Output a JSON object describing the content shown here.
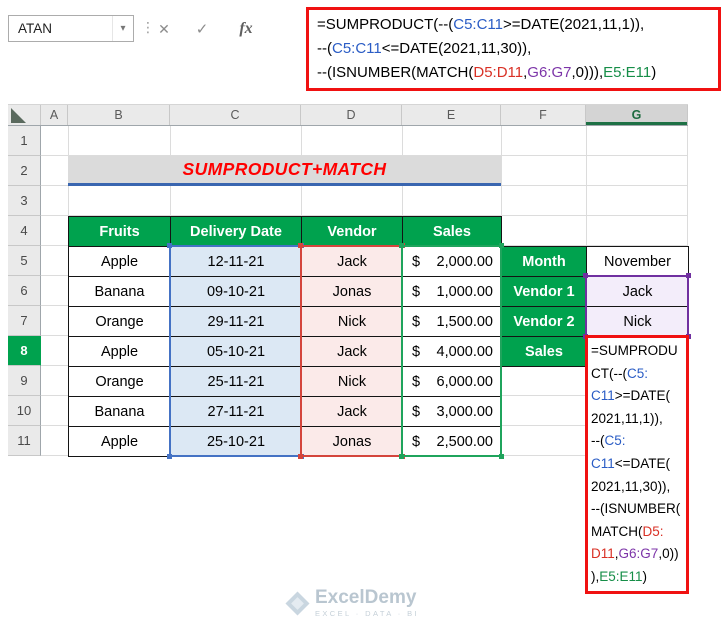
{
  "colors": {
    "header_green": "#00A24E",
    "selection_red": "#F01111",
    "title_text": "#FF0000",
    "title_bg": "#DBDBDB",
    "title_rule": "#3A66B0",
    "range_borders": {
      "c_column": "#4472C4",
      "d_column": "#D4453C",
      "e_column": "#1FA45C",
      "g_rows": "#7030A0"
    },
    "cell_fills": {
      "dates": "#DCE8F4",
      "vendors": "#FBEAE9",
      "lookup_vendors": "#F3EDFA"
    },
    "formula": {
      "plain": "#000000",
      "blue": "#2A5CC5",
      "red": "#D93025",
      "purple": "#7C34A8",
      "green": "#168E48"
    },
    "watermark_text": "#B9C6D0"
  },
  "name_box": {
    "value": "ATAN"
  },
  "toolbar": {
    "dropdown": "▾",
    "grip": "⋮",
    "cancel": "✕",
    "enter": "✓",
    "fx": "fx"
  },
  "formula_bar": {
    "lines": [
      [
        {
          "t": "=SUMPRODUCT(--("
        },
        {
          "t": "C5:C11",
          "c": "blue"
        },
        {
          "t": ">=DATE(2021,11,1)),"
        }
      ],
      [
        {
          "t": "--("
        },
        {
          "t": "C5:C11",
          "c": "blue"
        },
        {
          "t": "<=DATE(2021,11,30)),"
        }
      ],
      [
        {
          "t": "--(ISNUMBER(MATCH("
        },
        {
          "t": "D5:D11",
          "c": "red"
        },
        {
          "t": ","
        },
        {
          "t": "G6:G7",
          "c": "purple"
        },
        {
          "t": ",0))),"
        },
        {
          "t": "E5:E11",
          "c": "green"
        },
        {
          "t": ")"
        }
      ]
    ]
  },
  "sheet": {
    "columns": [
      "A",
      "B",
      "C",
      "D",
      "E",
      "F",
      "G"
    ],
    "rows": [
      "1",
      "2",
      "3",
      "4",
      "5",
      "6",
      "7",
      "8",
      "9",
      "10",
      "11"
    ],
    "active_cell": "G8"
  },
  "title": {
    "text": "SUMPRODUCT+MATCH"
  },
  "main_table": {
    "headers": [
      "Fruits",
      "Delivery Date",
      "Vendor",
      "Sales"
    ],
    "rows": [
      {
        "fruit": "Apple",
        "date": "12-11-21",
        "vendor": "Jack",
        "currency": "$",
        "sales": "2,000.00"
      },
      {
        "fruit": "Banana",
        "date": "09-10-21",
        "vendor": "Jonas",
        "currency": "$",
        "sales": "1,000.00"
      },
      {
        "fruit": "Orange",
        "date": "29-11-21",
        "vendor": "Nick",
        "currency": "$",
        "sales": "1,500.00"
      },
      {
        "fruit": "Apple",
        "date": "05-10-21",
        "vendor": "Jack",
        "currency": "$",
        "sales": "4,000.00"
      },
      {
        "fruit": "Orange",
        "date": "25-11-21",
        "vendor": "Nick",
        "currency": "$",
        "sales": "6,000.00"
      },
      {
        "fruit": "Banana",
        "date": "27-11-21",
        "vendor": "Jack",
        "currency": "$",
        "sales": "3,000.00"
      },
      {
        "fruit": "Apple",
        "date": "25-10-21",
        "vendor": "Jonas",
        "currency": "$",
        "sales": "2,500.00"
      }
    ]
  },
  "lookup_table": {
    "rows": [
      {
        "label": "Month",
        "value": "November"
      },
      {
        "label": "Vendor 1",
        "value": "Jack"
      },
      {
        "label": "Vendor 2",
        "value": "Nick"
      },
      {
        "label": "Sales",
        "value": ""
      }
    ]
  },
  "cell_formula": {
    "lines": [
      [
        {
          "t": "=SUMPRODU"
        }
      ],
      [
        {
          "t": "CT(--("
        },
        {
          "t": "C5:",
          "c": "blue"
        }
      ],
      [
        {
          "t": "C11",
          "c": "blue"
        },
        {
          "t": ">=DATE("
        }
      ],
      [
        {
          "t": "2021,11,1)),"
        }
      ],
      [
        {
          "t": "--("
        },
        {
          "t": "C5:",
          "c": "blue"
        }
      ],
      [
        {
          "t": "C11",
          "c": "blue"
        },
        {
          "t": "<=DATE("
        }
      ],
      [
        {
          "t": "2021,11,30)),"
        }
      ],
      [
        {
          "t": "--(ISNUMBER("
        }
      ],
      [
        {
          "t": "MATCH("
        },
        {
          "t": "D5:",
          "c": "red"
        }
      ],
      [
        {
          "t": "D11",
          "c": "red"
        },
        {
          "t": ","
        },
        {
          "t": "G6:G7",
          "c": "purple"
        },
        {
          "t": ",0))"
        }
      ],
      [
        {
          "t": "),"
        },
        {
          "t": "E5:E11",
          "c": "green"
        },
        {
          "t": ")"
        }
      ]
    ]
  },
  "watermark": {
    "brand": "ExcelDemy",
    "tagline": "EXCEL · DATA · BI"
  }
}
